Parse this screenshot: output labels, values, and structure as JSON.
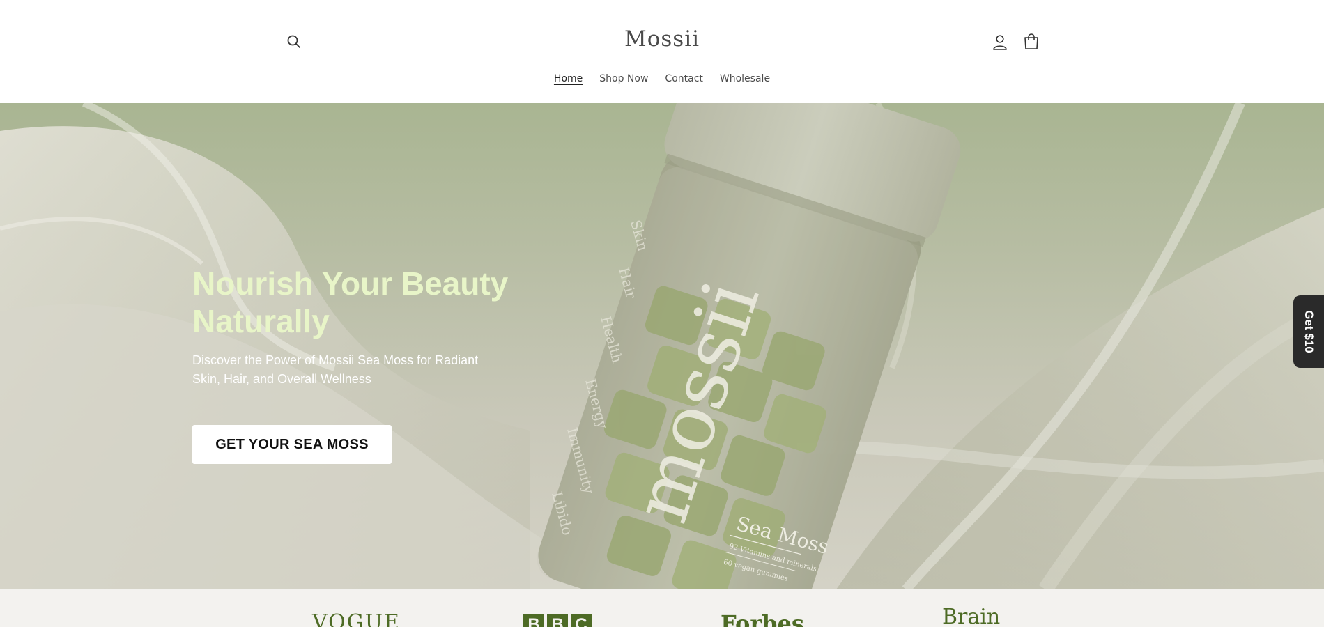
{
  "header": {
    "brand": "Mossii",
    "nav": [
      {
        "label": "Home",
        "active": true
      },
      {
        "label": "Shop Now",
        "active": false
      },
      {
        "label": "Contact",
        "active": false
      },
      {
        "label": "Wholesale",
        "active": false
      }
    ],
    "icons": [
      "search-icon",
      "account-icon",
      "cart-icon"
    ]
  },
  "hero": {
    "title": "Nourish Your Beauty Naturally",
    "subtitle": "Discover the Power of Mossii Sea Moss for Radiant Skin, Hair, and Overall Wellness",
    "cta_label": "GET YOUR SEA MOSS",
    "product_image": {
      "brand_text": "mossii",
      "product_name": "Sea Moss",
      "line1": "92 Vitamins and minerals",
      "line2": "60 vegan gummies",
      "side_words": [
        "Skin",
        "Hair",
        "Health",
        "Energy",
        "Immunity",
        "Libido"
      ]
    }
  },
  "side_tab": {
    "label": "Get $10"
  },
  "press": {
    "logos": [
      "VOGUE",
      "BBC",
      "Forbes",
      "Brain"
    ]
  },
  "colors": {
    "title_green": "#e8f5c8",
    "hero_bg": "#b7bda3",
    "press_green": "#4d6b25",
    "side_tab_bg": "#2a2a2a"
  }
}
